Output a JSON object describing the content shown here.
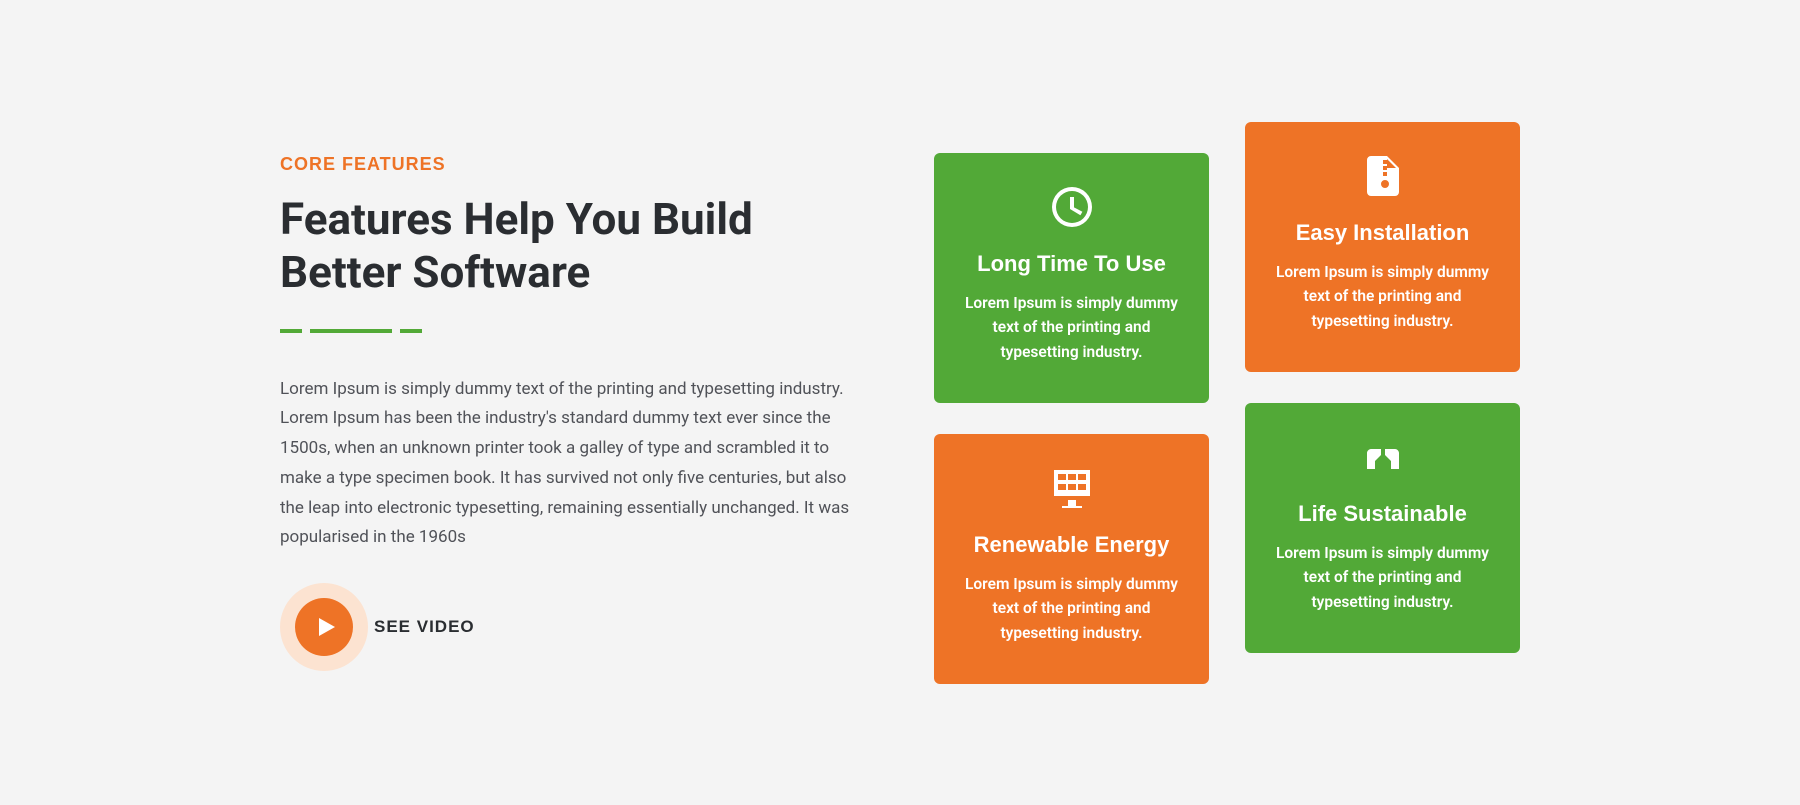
{
  "left": {
    "eyebrow": "CORE FEATURES",
    "heading": "Features Help You Build Better Software",
    "body": "Lorem Ipsum is simply dummy text of the printing and typesetting industry. Lorem Ipsum has been the industry's standard dummy text ever since the 1500s, when an unknown printer took a galley of type and scrambled it to make a type specimen book. It has survived not only five centuries, but also the leap into electronic typesetting, remaining essentially unchanged. It was popularised in the 1960s",
    "video_label": "SEE VIDEO"
  },
  "cards": [
    {
      "title": "Long Time To Use",
      "desc": "Lorem Ipsum is simply dummy text of the printing and typesetting industry."
    },
    {
      "title": "Easy Installation",
      "desc": "Lorem Ipsum is simply dummy text of the printing and typesetting industry."
    },
    {
      "title": "Renewable Energy",
      "desc": "Lorem Ipsum is simply dummy text of the printing and typesetting industry."
    },
    {
      "title": "Life Sustainable",
      "desc": "Lorem Ipsum is simply dummy text of the printing and typesetting industry."
    }
  ]
}
